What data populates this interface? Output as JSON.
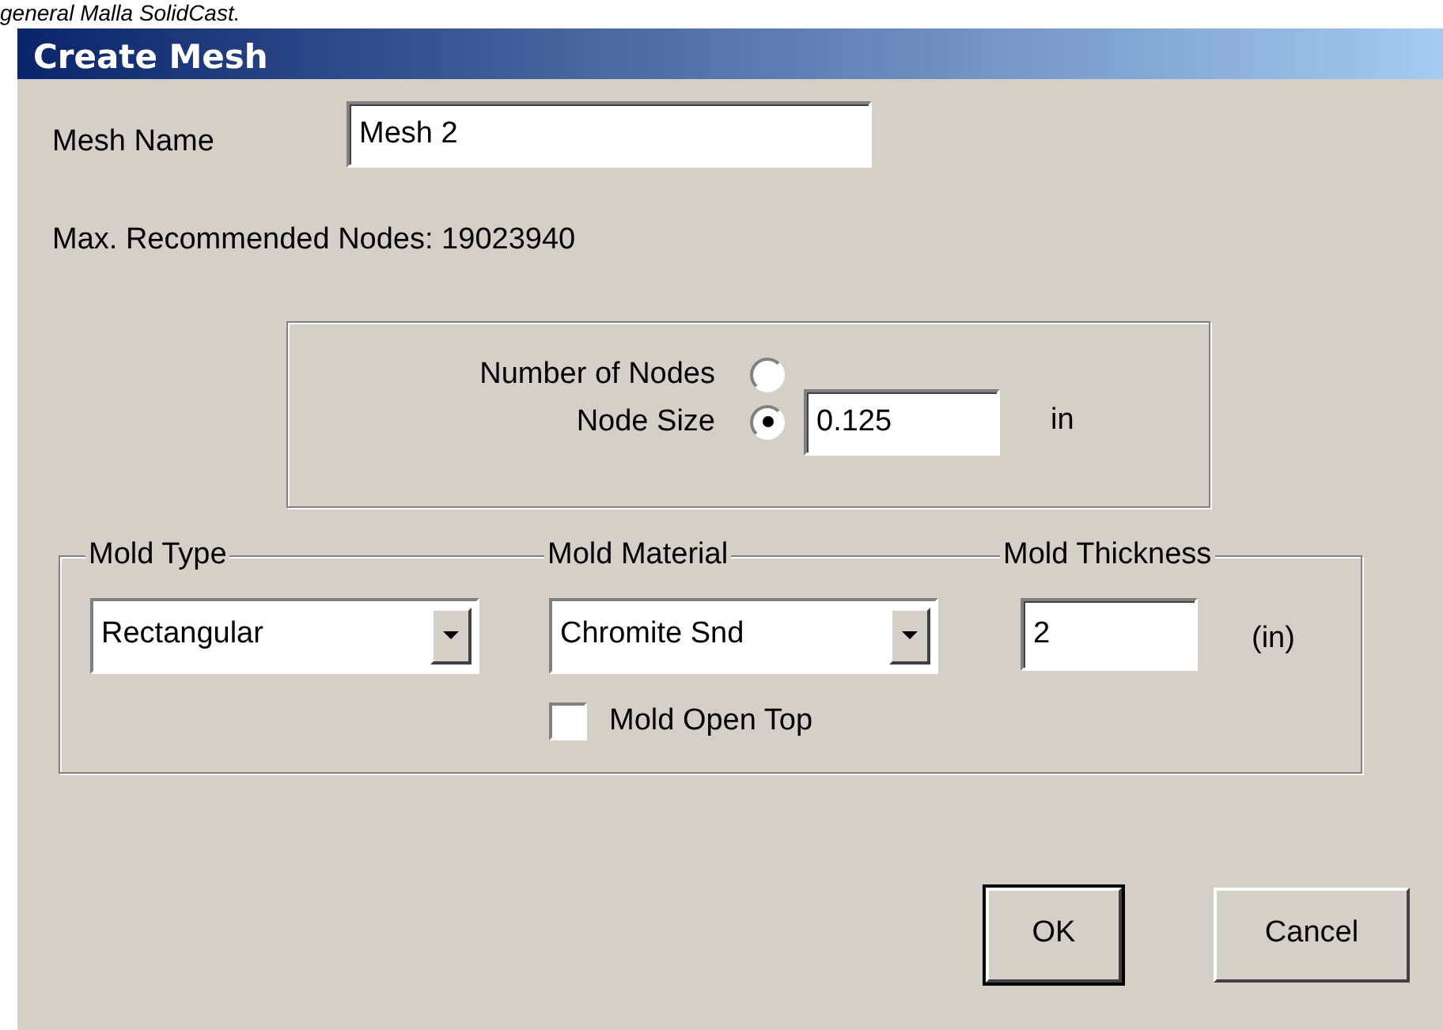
{
  "caption": "general Malla SolidCast.",
  "window": {
    "title": "Create Mesh"
  },
  "mesh_name": {
    "label": "Mesh Name",
    "value": "Mesh 2"
  },
  "max_nodes": "Max. Recommended Nodes: 19023940",
  "size_mode": {
    "options": [
      {
        "label": "Number of Nodes",
        "selected": false
      },
      {
        "label": "Node Size",
        "selected": true
      }
    ],
    "value": "0.125",
    "unit": "in"
  },
  "mold": {
    "type": {
      "label": "Mold Type",
      "value": "Rectangular"
    },
    "material": {
      "label": "Mold Material",
      "value": "Chromite Snd"
    },
    "thickness": {
      "label": "Mold Thickness",
      "value": "2",
      "unit": "(in)"
    },
    "open_top": {
      "label": "Mold Open Top",
      "checked": false
    }
  },
  "buttons": [
    {
      "label": "OK",
      "default": true
    },
    {
      "label": "Cancel",
      "default": false
    }
  ]
}
